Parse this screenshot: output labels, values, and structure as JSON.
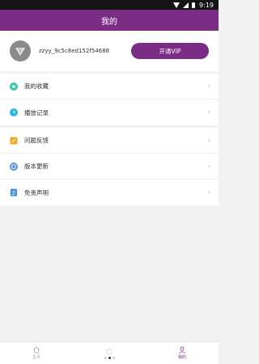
{
  "status_bar": {
    "time": "9:19"
  },
  "header": {
    "title": "我的"
  },
  "profile": {
    "username": "zzyy_9c5c8ed152f54688",
    "vip_button_label": "开通VIP",
    "avatar_letter": "V"
  },
  "menu_group_1": [
    {
      "label": "我的收藏",
      "icon": "star-circle-icon",
      "icon_color": "#2fc9a4"
    },
    {
      "label": "播放记录",
      "icon": "clock-icon",
      "icon_color": "#2db7e0"
    }
  ],
  "menu_group_2": [
    {
      "label": "问题反馈",
      "icon": "feedback-icon",
      "icon_color": "#f5a623"
    },
    {
      "label": "版本更新",
      "icon": "update-icon",
      "icon_color": "#5a8ee8"
    },
    {
      "label": "免责声明",
      "icon": "document-icon",
      "icon_color": "#3a8ee6"
    }
  ],
  "bottom_nav": {
    "items": [
      {
        "label": "主页",
        "icon": "home-icon",
        "active": false
      },
      {
        "label": "",
        "icon": "dots-icon",
        "active": false
      },
      {
        "label": "我的",
        "icon": "user-icon",
        "active": true
      }
    ]
  },
  "colors": {
    "brand": "#7b2c85",
    "background": "#f2f2f2"
  }
}
